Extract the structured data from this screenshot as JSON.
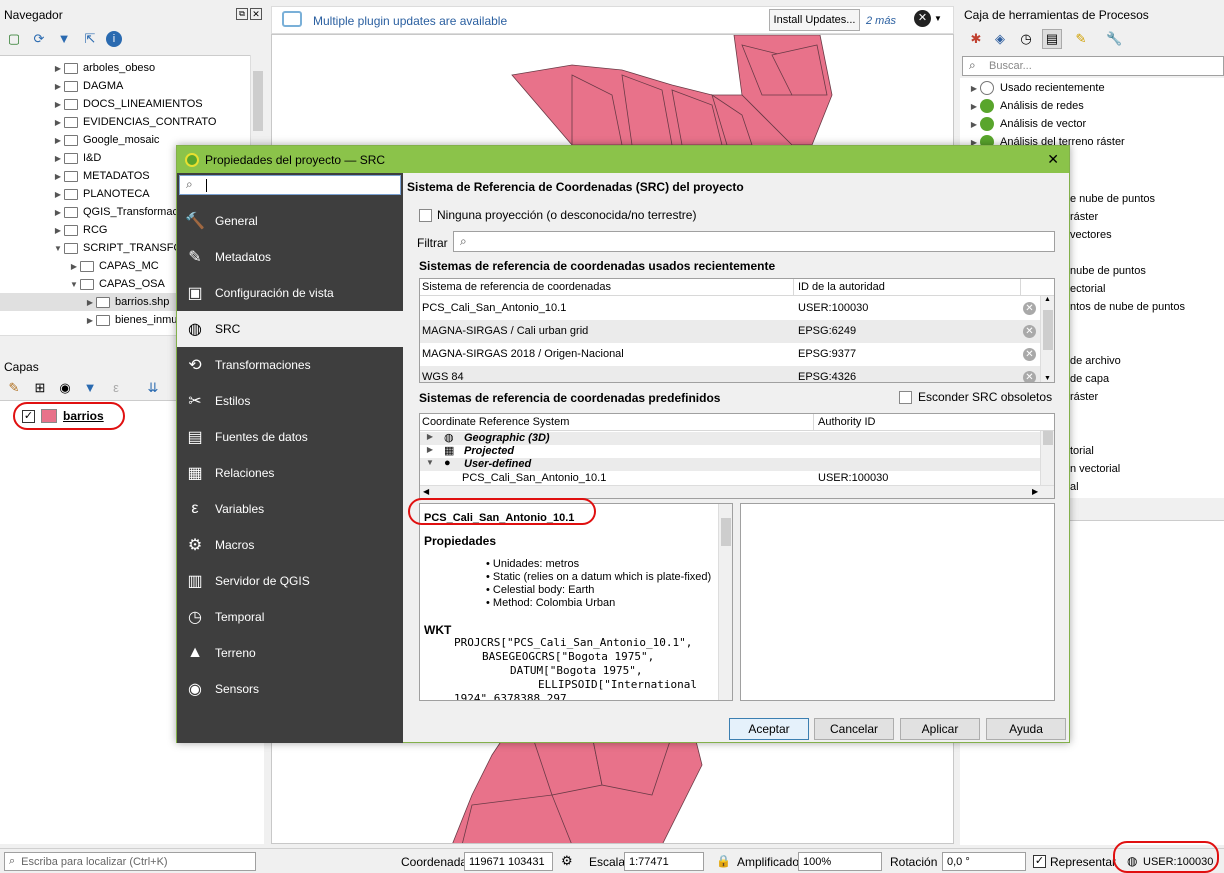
{
  "navigator": {
    "title": "Navegador",
    "items": [
      "arboles_obeso",
      "DAGMA",
      "DOCS_LINEAMIENTOS",
      "EVIDENCIAS_CONTRATO",
      "Google_mosaic",
      "I&D",
      "METADATOS",
      "PLANOTECA",
      "QGIS_Transformac",
      "RCG",
      "SCRIPT_TRANSFO",
      "CAPAS_MC",
      "CAPAS_OSA",
      "barrios.shp",
      "bienes_inmu"
    ]
  },
  "layers": {
    "title": "Capas",
    "layer_name": "barrios",
    "layer_color": "#e8728a"
  },
  "plugin_bar": {
    "message": "Multiple plugin updates are available",
    "install_label": "Install Updates...",
    "more_label": "2 más"
  },
  "toolbox": {
    "title": "Caja de herramientas de Procesos",
    "search_placeholder": "Buscar...",
    "items": [
      "Usado recientemente",
      "Análisis de redes",
      "Análisis de vector",
      "Análisis del terreno ráster"
    ],
    "partial": [
      "e nube de puntos",
      "ráster",
      "vectores",
      "nube de puntos",
      "ectorial",
      "ntos de nube de puntos",
      "de archivo",
      "de capa",
      "ráster",
      "torial",
      "n vectorial",
      "al"
    ]
  },
  "dialog": {
    "title": "Propiedades del proyecto — SRC",
    "section_title": "Sistema de Referencia de Coordenadas (SRC) del proyecto",
    "no_projection": "Ninguna proyección (o desconocida/no terrestre)",
    "filter_label": "Filtrar",
    "recent_title": "Sistemas de referencia de coordenadas usados recientemente",
    "recent_headers": [
      "Sistema de referencia de coordenadas",
      "ID de la autoridad"
    ],
    "recent_rows": [
      {
        "name": "PCS_Cali_San_Antonio_10.1",
        "id": "USER:100030"
      },
      {
        "name": "MAGNA-SIRGAS / Cali urban grid",
        "id": "EPSG:6249"
      },
      {
        "name": "MAGNA-SIRGAS 2018 / Origen-Nacional",
        "id": "EPSG:9377"
      },
      {
        "name": "WGS 84",
        "id": "EPSG:4326"
      }
    ],
    "predef_title": "Sistemas de referencia de coordenadas predefinidos",
    "hide_obsolete": "Esconder SRC obsoletos",
    "predef_headers": [
      "Coordinate Reference System",
      "Authority ID"
    ],
    "predef_groups": [
      "Geographic (3D)",
      "Projected",
      "User-defined"
    ],
    "predef_child": {
      "name": "PCS_Cali_San_Antonio_10.1",
      "id": "USER:100030"
    },
    "selected_crs": "PCS_Cali_San_Antonio_10.1",
    "props_title": "Propiedades",
    "props": [
      "Unidades: metros",
      "Static (relies on a datum which is plate-fixed)",
      "Celestial body: Earth",
      "Method: Colombia Urban"
    ],
    "wkt_title": "WKT",
    "wkt_lines": [
      "PROJCRS[\"PCS_Cali_San_Antonio_10.1\",",
      "BASEGEOGCRS[\"Bogota 1975\",",
      "DATUM[\"Bogota 1975\",",
      "ELLIPSOID[\"International",
      "1924\",6378388,297"
    ],
    "sidebar": [
      "General",
      "Metadatos",
      "Configuración de vista",
      "SRC",
      "Transformaciones",
      "Estilos",
      "Fuentes de datos",
      "Relaciones",
      "Variables",
      "Macros",
      "Servidor de QGIS",
      "Temporal",
      "Terreno",
      "Sensors"
    ],
    "buttons": {
      "ok": "Aceptar",
      "cancel": "Cancelar",
      "apply": "Aplicar",
      "help": "Ayuda"
    }
  },
  "status": {
    "locate_placeholder": "Escriba para localizar (Ctrl+K)",
    "coord_label": "Coordenada",
    "coord_value": "119671 103431",
    "scale_label": "Escala",
    "scale_value": "1:77471",
    "magnifier_label": "Amplificador",
    "magnifier_value": "100%",
    "rotation_label": "Rotación",
    "rotation_value": "0,0 °",
    "render_label": "Representar",
    "crs_value": "USER:100030"
  }
}
